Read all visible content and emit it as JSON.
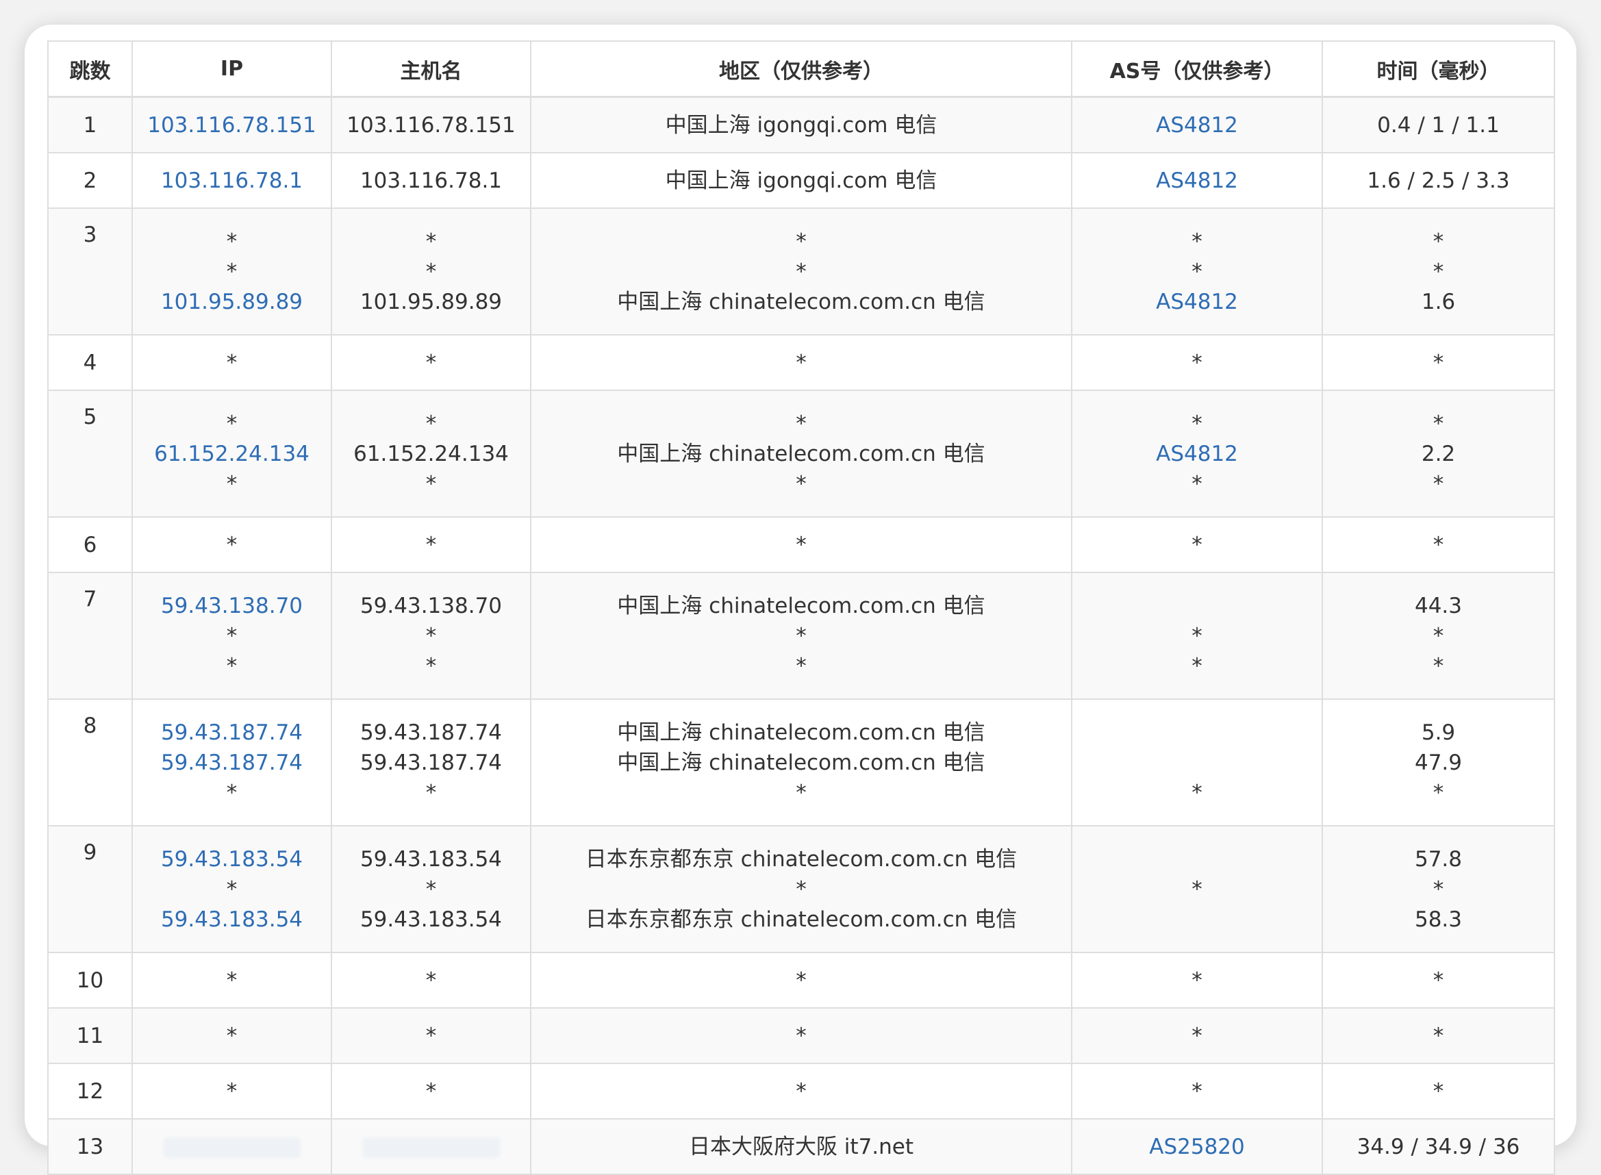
{
  "headers": [
    "跳数",
    "IP",
    "主机名",
    "地区（仅供参考）",
    "AS号（仅供参考）",
    "时间（毫秒）"
  ],
  "rows": [
    {
      "hop": "1",
      "ip": [
        "103.116.78.151"
      ],
      "host": [
        "103.116.78.151"
      ],
      "region": [
        "中国上海 igongqi.com 电信"
      ],
      "as": [
        "AS4812"
      ],
      "time": [
        "0.4 / 1 / 1.1"
      ]
    },
    {
      "hop": "2",
      "ip": [
        "103.116.78.1"
      ],
      "host": [
        "103.116.78.1"
      ],
      "region": [
        "中国上海 igongqi.com 电信"
      ],
      "as": [
        "AS4812"
      ],
      "time": [
        "1.6 / 2.5 / 3.3"
      ]
    },
    {
      "hop": "3",
      "ip": [
        "*",
        "*",
        "101.95.89.89"
      ],
      "host": [
        "*",
        "*",
        "101.95.89.89"
      ],
      "region": [
        "*",
        "*",
        "中国上海 chinatelecom.com.cn 电信"
      ],
      "as": [
        "*",
        "*",
        "AS4812"
      ],
      "time": [
        "*",
        "*",
        "1.6"
      ]
    },
    {
      "hop": "4",
      "ip": [
        "*"
      ],
      "host": [
        "*"
      ],
      "region": [
        "*"
      ],
      "as": [
        "*"
      ],
      "time": [
        "*"
      ]
    },
    {
      "hop": "5",
      "ip": [
        "*",
        "61.152.24.134",
        "*"
      ],
      "host": [
        "*",
        "61.152.24.134",
        "*"
      ],
      "region": [
        "*",
        "中国上海 chinatelecom.com.cn 电信",
        "*"
      ],
      "as": [
        "*",
        "AS4812",
        "*"
      ],
      "time": [
        "*",
        "2.2",
        "*"
      ]
    },
    {
      "hop": "6",
      "ip": [
        "*"
      ],
      "host": [
        "*"
      ],
      "region": [
        "*"
      ],
      "as": [
        "*"
      ],
      "time": [
        "*"
      ]
    },
    {
      "hop": "7",
      "ip": [
        "59.43.138.70",
        "*",
        "*"
      ],
      "host": [
        "59.43.138.70",
        "*",
        "*"
      ],
      "region": [
        "中国上海 chinatelecom.com.cn 电信",
        "*",
        "*"
      ],
      "as": [
        "",
        "*",
        "*"
      ],
      "time": [
        "44.3",
        "*",
        "*"
      ]
    },
    {
      "hop": "8",
      "ip": [
        "59.43.187.74",
        "59.43.187.74",
        "*"
      ],
      "host": [
        "59.43.187.74",
        "59.43.187.74",
        "*"
      ],
      "region": [
        "中国上海 chinatelecom.com.cn 电信",
        "中国上海 chinatelecom.com.cn 电信",
        "*"
      ],
      "as": [
        "",
        "",
        "*"
      ],
      "time": [
        "5.9",
        "47.9",
        "*"
      ]
    },
    {
      "hop": "9",
      "ip": [
        "59.43.183.54",
        "*",
        "59.43.183.54"
      ],
      "host": [
        "59.43.183.54",
        "*",
        "59.43.183.54"
      ],
      "region": [
        "日本东京都东京 chinatelecom.com.cn 电信",
        "*",
        "日本东京都东京 chinatelecom.com.cn 电信"
      ],
      "as": [
        "",
        "*",
        ""
      ],
      "time": [
        "57.8",
        "*",
        "58.3"
      ]
    },
    {
      "hop": "10",
      "ip": [
        "*"
      ],
      "host": [
        "*"
      ],
      "region": [
        "*"
      ],
      "as": [
        "*"
      ],
      "time": [
        "*"
      ]
    },
    {
      "hop": "11",
      "ip": [
        "*"
      ],
      "host": [
        "*"
      ],
      "region": [
        "*"
      ],
      "as": [
        "*"
      ],
      "time": [
        "*"
      ]
    },
    {
      "hop": "12",
      "ip": [
        "*"
      ],
      "host": [
        "*"
      ],
      "region": [
        "*"
      ],
      "as": [
        "*"
      ],
      "time": [
        "*"
      ]
    },
    {
      "hop": "13",
      "ip": [
        ""
      ],
      "host": [
        ""
      ],
      "region": [
        "日本大阪府大阪 it7.net"
      ],
      "as": [
        "AS25820"
      ],
      "time": [
        "34.9 / 34.9 / 36"
      ],
      "redacted": true
    }
  ]
}
